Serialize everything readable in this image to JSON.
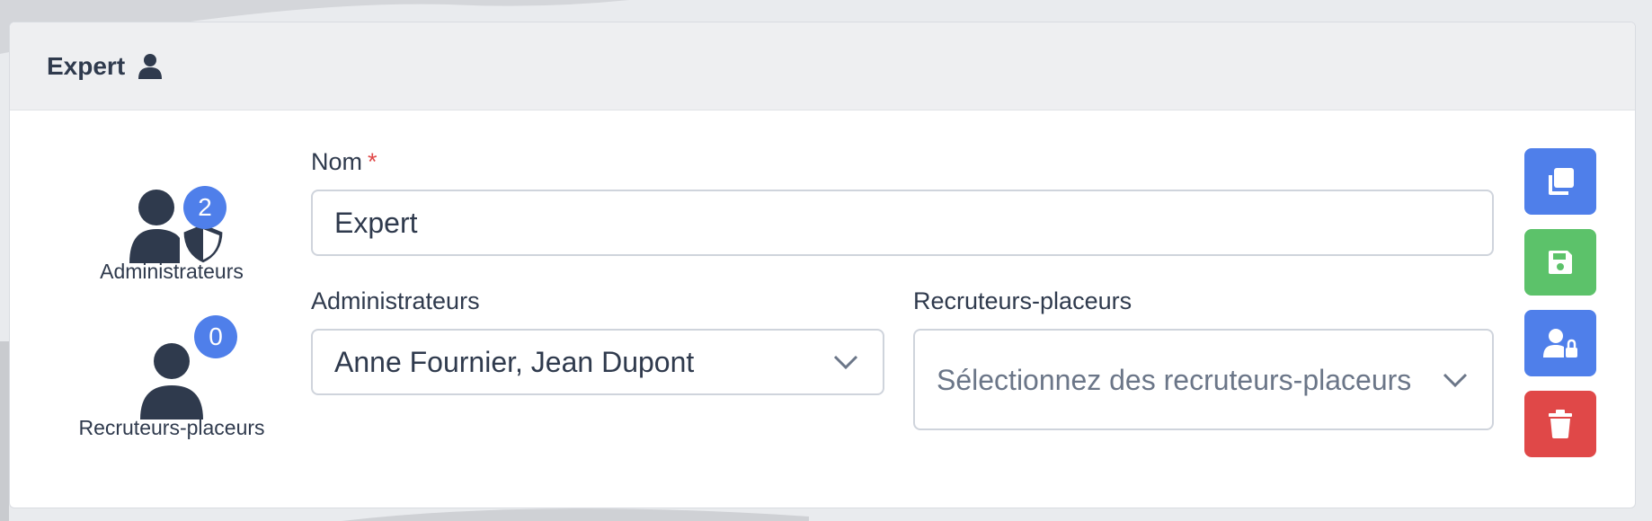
{
  "card": {
    "title": "Expert"
  },
  "stats": {
    "administrateurs": {
      "count": "2",
      "label": "Administrateurs"
    },
    "recruteurs": {
      "count": "0",
      "label": "Recruteurs-placeurs"
    }
  },
  "form": {
    "nom": {
      "label": "Nom",
      "required_mark": "*",
      "value": "Expert"
    },
    "administrateurs": {
      "label": "Administrateurs",
      "value": "Anne Fournier, Jean Dupont"
    },
    "recruteurs": {
      "label": "Recruteurs-placeurs",
      "placeholder": "Sélectionnez des recruteurs-placeurs"
    }
  },
  "actions": [
    {
      "name": "duplicate",
      "icon": "copy-icon",
      "color": "#4f7fea"
    },
    {
      "name": "save",
      "icon": "save-icon",
      "color": "#5cc26a"
    },
    {
      "name": "permissions",
      "icon": "user-lock-icon",
      "color": "#4f7fea"
    },
    {
      "name": "delete",
      "icon": "trash-icon",
      "color": "#e04848"
    }
  ],
  "colors": {
    "accent": "#4f7fea",
    "success": "#5cc26a",
    "danger": "#e04848",
    "text": "#2f3a4d"
  }
}
